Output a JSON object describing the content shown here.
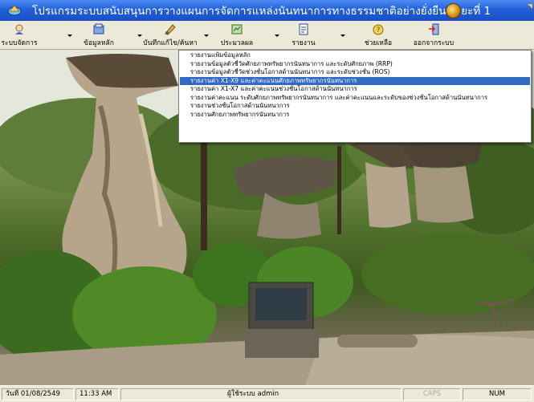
{
  "window": {
    "title": "โปรแกรมระบบสนับสนุนการวางแผนการจัดการแหล่งนันทนาการทางธรรมชาติอย่างยั่งยืน ระยะที่ 1"
  },
  "toolbar": {
    "items": [
      {
        "label": "ระบบจัดการ",
        "icon": "system-management-icon",
        "has_dropdown": true
      },
      {
        "label": "ข้อมูลหลัก",
        "icon": "main-data-icon",
        "has_dropdown": true
      },
      {
        "label": "บันทึกแก้ไข/ค้นหา",
        "icon": "edit-search-icon",
        "has_dropdown": true
      },
      {
        "label": "ประมวลผล",
        "icon": "process-icon",
        "has_dropdown": true
      },
      {
        "label": "รายงาน",
        "icon": "report-icon",
        "has_dropdown": true
      },
      {
        "label": "ช่วยเหลือ",
        "icon": "help-icon",
        "has_dropdown": false
      },
      {
        "label": "ออกจากระบบ",
        "icon": "exit-icon",
        "has_dropdown": false
      }
    ]
  },
  "report_menu": {
    "items": [
      "รายงานแฟ้มข้อมูลหลัก",
      "รายงานข้อมูลตัวชี้วัดศักยภาพทรัพยากรนันทนาการ และระดับศักยภาพ (RRP)",
      "รายงานข้อมูลตัวชี้วัดช่วงชั้นโอกาสด้านนันทนาการ และระดับช่วงชั้น (ROS)",
      "รายงานค่า X1-X9 และค่าคะแนนศักยภาพทรัพยากรนันทนาการ",
      "รายงานค่า X1-X7 และค่าคะแนนช่วงชั้นโอกาสด้านนันทนาการ",
      "รายงานค่าคะแนน ระดับศักยภาพทรัพยากรนันทนาการ และค่าคะแนนและระดับของช่วงชั้นโอกาสด้านนันทนาการ",
      "รายงานช่วงชั้นโอกาสด้านนันทนาการ",
      "รายงานศักยภาพทรัพยากรนันทนาการ"
    ],
    "highlighted_index": 3
  },
  "statusbar": {
    "date": "วันที่ 01/08/2549",
    "time": "11:33 AM",
    "user": "ผู้ใช้ระบบ admin",
    "caps": "CAPS",
    "num": "NUM"
  },
  "colors": {
    "titlebar": "#2160d8",
    "menu_highlight": "#316ac5",
    "toolbar_bg": "#ece9d8"
  }
}
